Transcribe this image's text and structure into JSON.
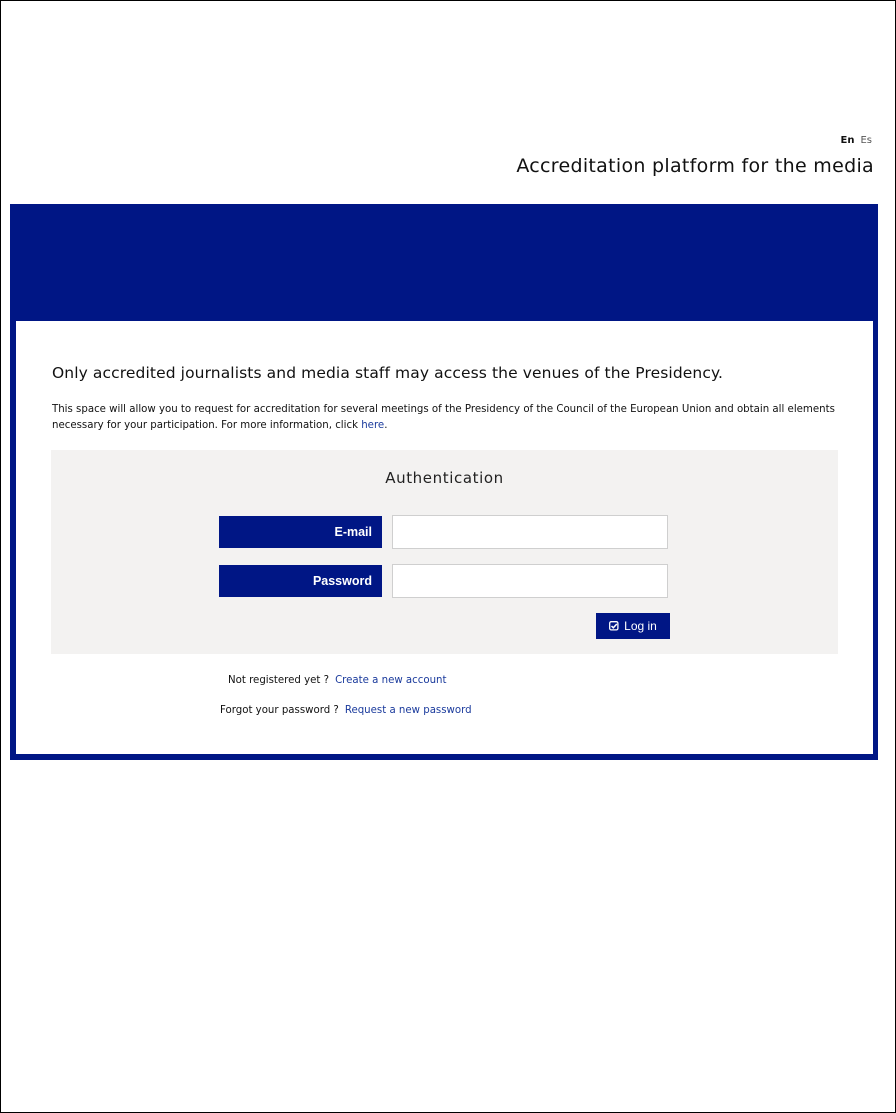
{
  "header": {
    "languages": [
      {
        "label": "En",
        "active": true
      },
      {
        "label": "Es",
        "active": false
      }
    ],
    "title": "Accreditation platform for the media"
  },
  "intro": {
    "heading": "Only accredited journalists and media staff may access the venues of the Presidency.",
    "text": "This space will allow you to request for accreditation for several meetings of the Presidency of the Council of the European Union and obtain all elements necessary for your participation. For more information, click ",
    "link_label": "here",
    "text_end": "."
  },
  "auth": {
    "title": "Authentication",
    "email_label": "E-mail",
    "email_value": "",
    "password_label": "Password",
    "password_value": "",
    "login_label": "Log in",
    "login_icon": "check-square-icon"
  },
  "links": {
    "register_question": "Not registered yet ?",
    "register_link": "Create a new account",
    "forgot_question": "Forgot your password ?",
    "forgot_link": "Request a new password"
  },
  "colors": {
    "brand": "#001685",
    "panel": "#f3f2f1",
    "link": "#1a3a9c"
  }
}
